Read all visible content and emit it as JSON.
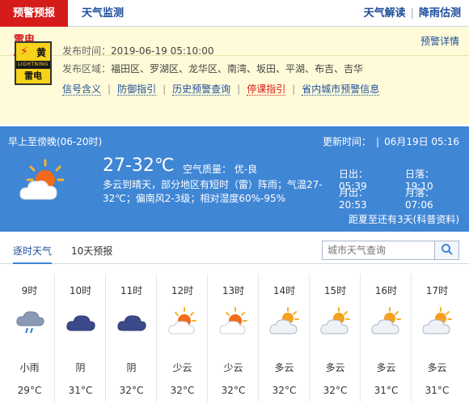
{
  "top": {
    "warning_tab": "预警预报",
    "monitor_tab": "天气监测",
    "right_links": [
      "天气解读",
      "降雨估测"
    ]
  },
  "warning": {
    "type": "雷电",
    "detail_link": "预警详情",
    "badge": {
      "level_char": "黄",
      "english": "LIGHTNING",
      "name": "雷电",
      "color": "#f6d31a"
    },
    "issue_label": "发布时间：",
    "issue_time": "2019-06-19 05:10:00",
    "area_label": "发布区域：",
    "areas": "福田区、罗湖区、龙华区、南湾、坂田、平湖、布吉、吉华",
    "links": [
      {
        "label": "信号含义",
        "color": "blue"
      },
      {
        "label": "防御指引",
        "color": "blue"
      },
      {
        "label": "历史预警查询",
        "color": "blue"
      },
      {
        "label": "停课指引",
        "color": "red"
      },
      {
        "label": "省内城市预警信息",
        "color": "blue"
      }
    ]
  },
  "forecast": {
    "period": "早上至傍晚(06-20时)",
    "temperature": "27-32℃",
    "air_quality": "空气质量： 优-良",
    "description": "多云到晴天，部分地区有短时（雷）阵雨；气温27-32℃；偏南风2-3级；相对湿度60%-95%",
    "update_label": "更新时间：",
    "update_time": "06月19日 05:16",
    "sunrise": "日出：05:39",
    "sunset": "日落：19:10",
    "moonrise": "月出：20:53",
    "moonset": "月落：07:06",
    "distance_note": "距夏至还有3天(科普资料)",
    "bg_color": "#3f86d5"
  },
  "hourly_tabs": [
    "逐时天气",
    "10天预报"
  ],
  "search": {
    "placeholder": "城市天气查询"
  },
  "hourly": [
    {
      "time": "9时",
      "icon": "rain-cloud-icon",
      "condition": "小雨",
      "temp": "29°C"
    },
    {
      "time": "10时",
      "icon": "overcast-cloud-icon",
      "condition": "阴",
      "temp": "31°C"
    },
    {
      "time": "11时",
      "icon": "overcast-cloud-icon",
      "condition": "阴",
      "temp": "32°C"
    },
    {
      "time": "12时",
      "icon": "partly-sunny-icon",
      "condition": "少云",
      "temp": "32°C"
    },
    {
      "time": "13时",
      "icon": "partly-sunny-icon",
      "condition": "少云",
      "temp": "32°C"
    },
    {
      "time": "14时",
      "icon": "mostly-cloudy-icon",
      "condition": "多云",
      "temp": "32°C"
    },
    {
      "time": "15时",
      "icon": "mostly-cloudy-icon",
      "condition": "多云",
      "temp": "32°C"
    },
    {
      "time": "16时",
      "icon": "mostly-cloudy-icon",
      "condition": "多云",
      "temp": "31°C"
    },
    {
      "time": "17时",
      "icon": "mostly-cloudy-icon",
      "condition": "多云",
      "temp": "31°C"
    }
  ]
}
